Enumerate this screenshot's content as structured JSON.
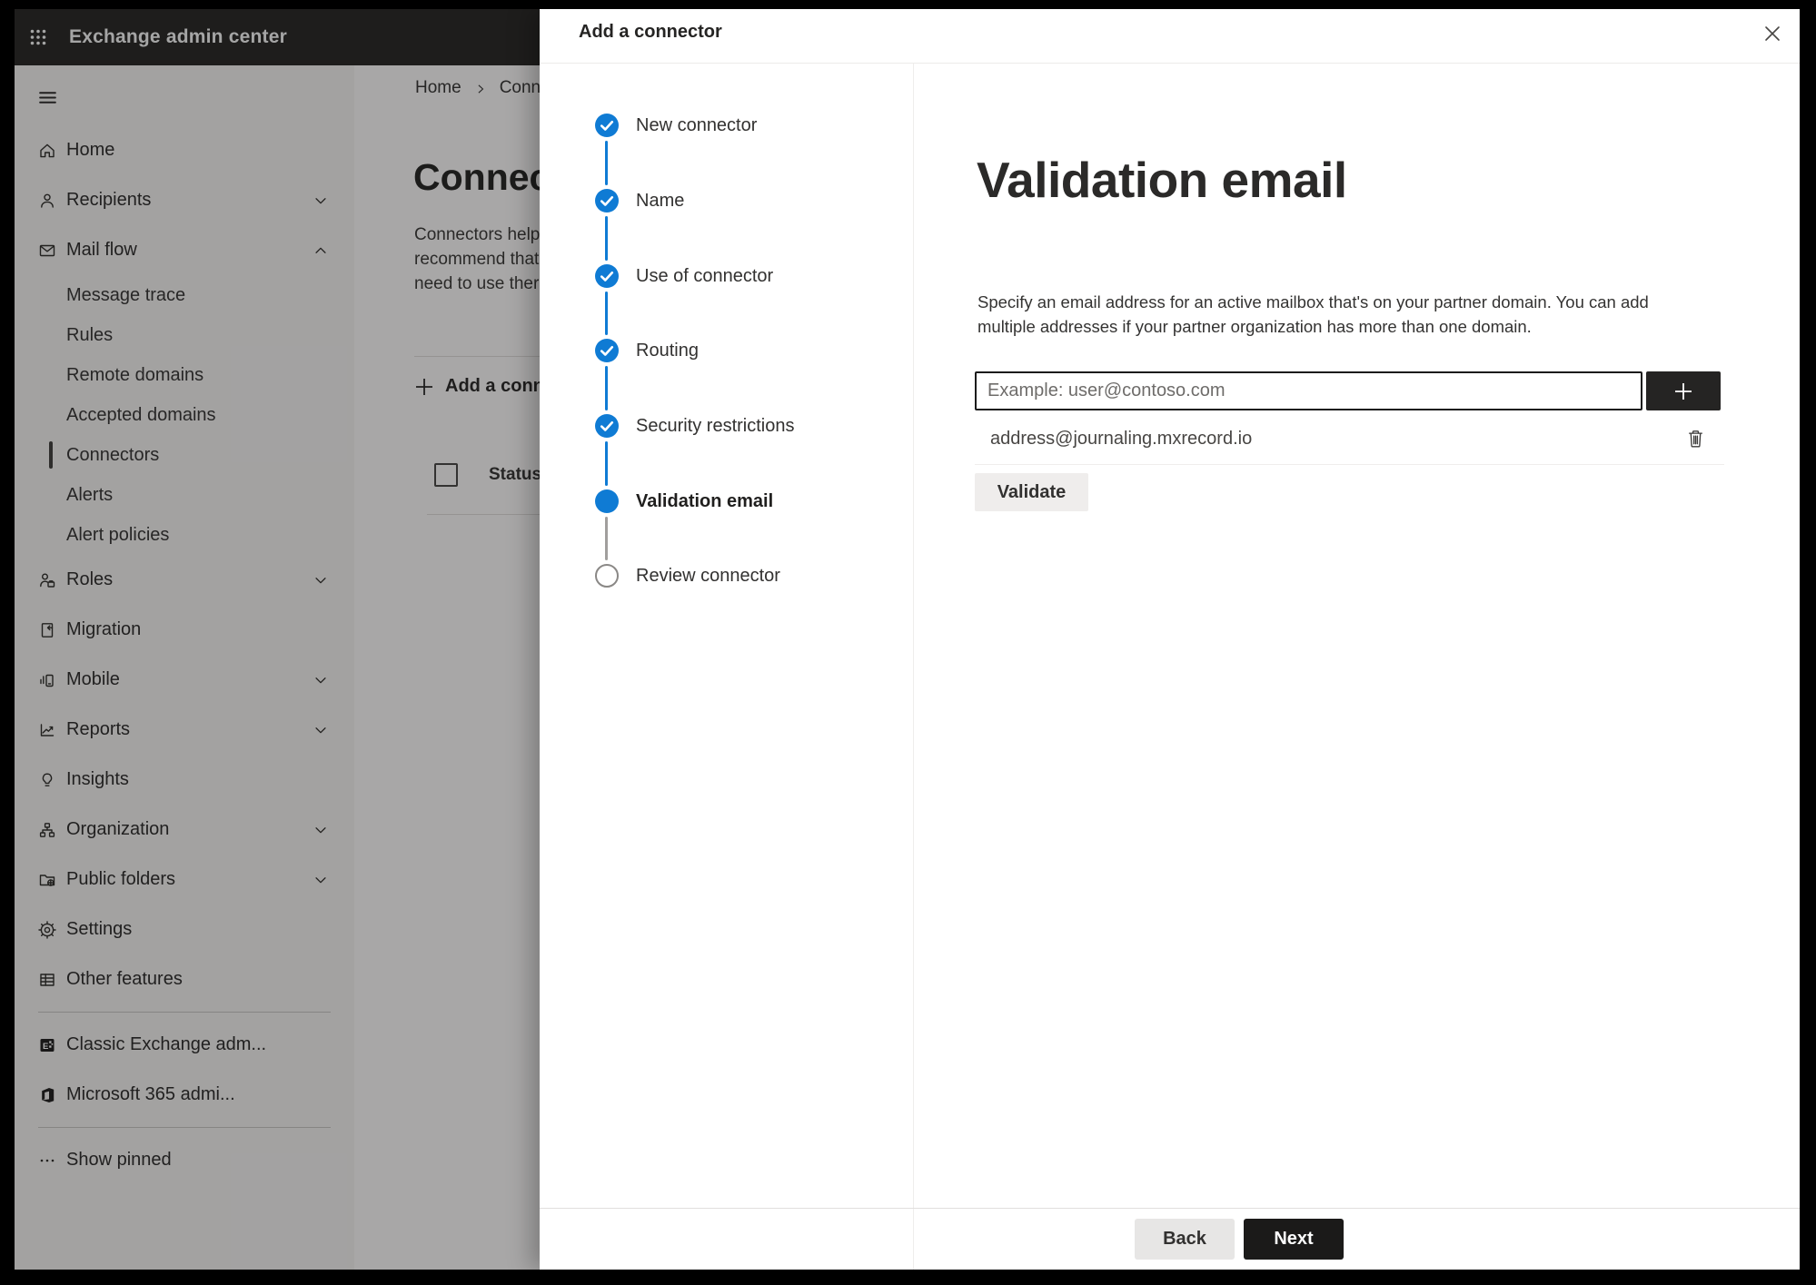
{
  "colors": {
    "accent_blue": "#0f7bd4",
    "pending_step_gray": "#8a8886",
    "dark_button": "#1b1a19",
    "topbar_dark": "#2d2c2a"
  },
  "topbar": {
    "app_launcher_icon": "waffle-icon",
    "title": "Exchange admin center"
  },
  "sidebar": {
    "menu_icon": "hamburger-icon",
    "items": [
      {
        "id": "home",
        "label": "Home",
        "icon": "house-icon"
      },
      {
        "id": "recipients",
        "label": "Recipients",
        "icon": "person-icon",
        "chevron": "down"
      },
      {
        "id": "mail-flow",
        "label": "Mail flow",
        "icon": "envelope-icon",
        "chevron": "up"
      },
      {
        "id": "message-trace",
        "label": "Message trace",
        "indent": true
      },
      {
        "id": "rules",
        "label": "Rules",
        "indent": true
      },
      {
        "id": "remote-domains",
        "label": "Remote domains",
        "indent": true
      },
      {
        "id": "accepted-domains",
        "label": "Accepted domains",
        "indent": true
      },
      {
        "id": "connectors",
        "label": "Connectors",
        "indent": true,
        "selected": true
      },
      {
        "id": "alerts",
        "label": "Alerts",
        "indent": true
      },
      {
        "id": "alert-policies",
        "label": "Alert policies",
        "indent": true
      },
      {
        "id": "roles",
        "label": "Roles",
        "icon": "person-badge-icon",
        "chevron": "down"
      },
      {
        "id": "migration",
        "label": "Migration",
        "icon": "document-arrow-icon"
      },
      {
        "id": "mobile",
        "label": "Mobile",
        "icon": "mobile-chart-icon",
        "chevron": "down"
      },
      {
        "id": "reports",
        "label": "Reports",
        "icon": "line-chart-icon",
        "chevron": "down"
      },
      {
        "id": "insights",
        "label": "Insights",
        "icon": "lightbulb-icon"
      },
      {
        "id": "organization",
        "label": "Organization",
        "icon": "org-chart-icon",
        "chevron": "down"
      },
      {
        "id": "public-folders",
        "label": "Public folders",
        "icon": "folder-globe-icon",
        "chevron": "down"
      },
      {
        "id": "settings",
        "label": "Settings",
        "icon": "gear-icon"
      },
      {
        "id": "other-features",
        "label": "Other features",
        "icon": "grid-icon"
      },
      {
        "divider": true
      },
      {
        "id": "classic-exchange",
        "label": "Classic Exchange adm...",
        "icon": "exchange-logo-icon"
      },
      {
        "id": "microsoft-365",
        "label": "Microsoft 365 admi...",
        "icon": "office-logo-icon"
      },
      {
        "divider": true
      },
      {
        "id": "show-pinned",
        "label": "Show pinned",
        "icon": "ellipsis-icon"
      }
    ]
  },
  "background_page": {
    "breadcrumb": {
      "home": "Home",
      "separator_icon": "chevron-right-icon",
      "current": "Conne"
    },
    "heading": "Connec",
    "paragraph_lines": [
      "Connectors help",
      "recommend that",
      "need to use ther"
    ],
    "add_connector_label": "Add a conn",
    "status_column": "Status"
  },
  "panel": {
    "title": "Add a connector",
    "close_icon": "close-icon",
    "steps": [
      {
        "label": "New connector",
        "state": "completed"
      },
      {
        "label": "Name",
        "state": "completed"
      },
      {
        "label": "Use of connector",
        "state": "completed"
      },
      {
        "label": "Routing",
        "state": "completed"
      },
      {
        "label": "Security restrictions",
        "state": "completed"
      },
      {
        "label": "Validation email",
        "state": "current"
      },
      {
        "label": "Review connector",
        "state": "pending"
      }
    ],
    "content": {
      "heading": "Validation email",
      "description_line1": "Specify an email address for an active mailbox that's on your partner domain. You can add",
      "description_line2": "multiple addresses if your partner organization has more than one domain.",
      "email_input_placeholder": "Example: user@contoso.com",
      "add_address_icon": "plus-icon",
      "addresses": [
        {
          "email": "address@journaling.mxrecord.io",
          "delete_icon": "trash-icon"
        }
      ],
      "validate_label": "Validate"
    },
    "footer": {
      "back_label": "Back",
      "next_label": "Next"
    }
  }
}
